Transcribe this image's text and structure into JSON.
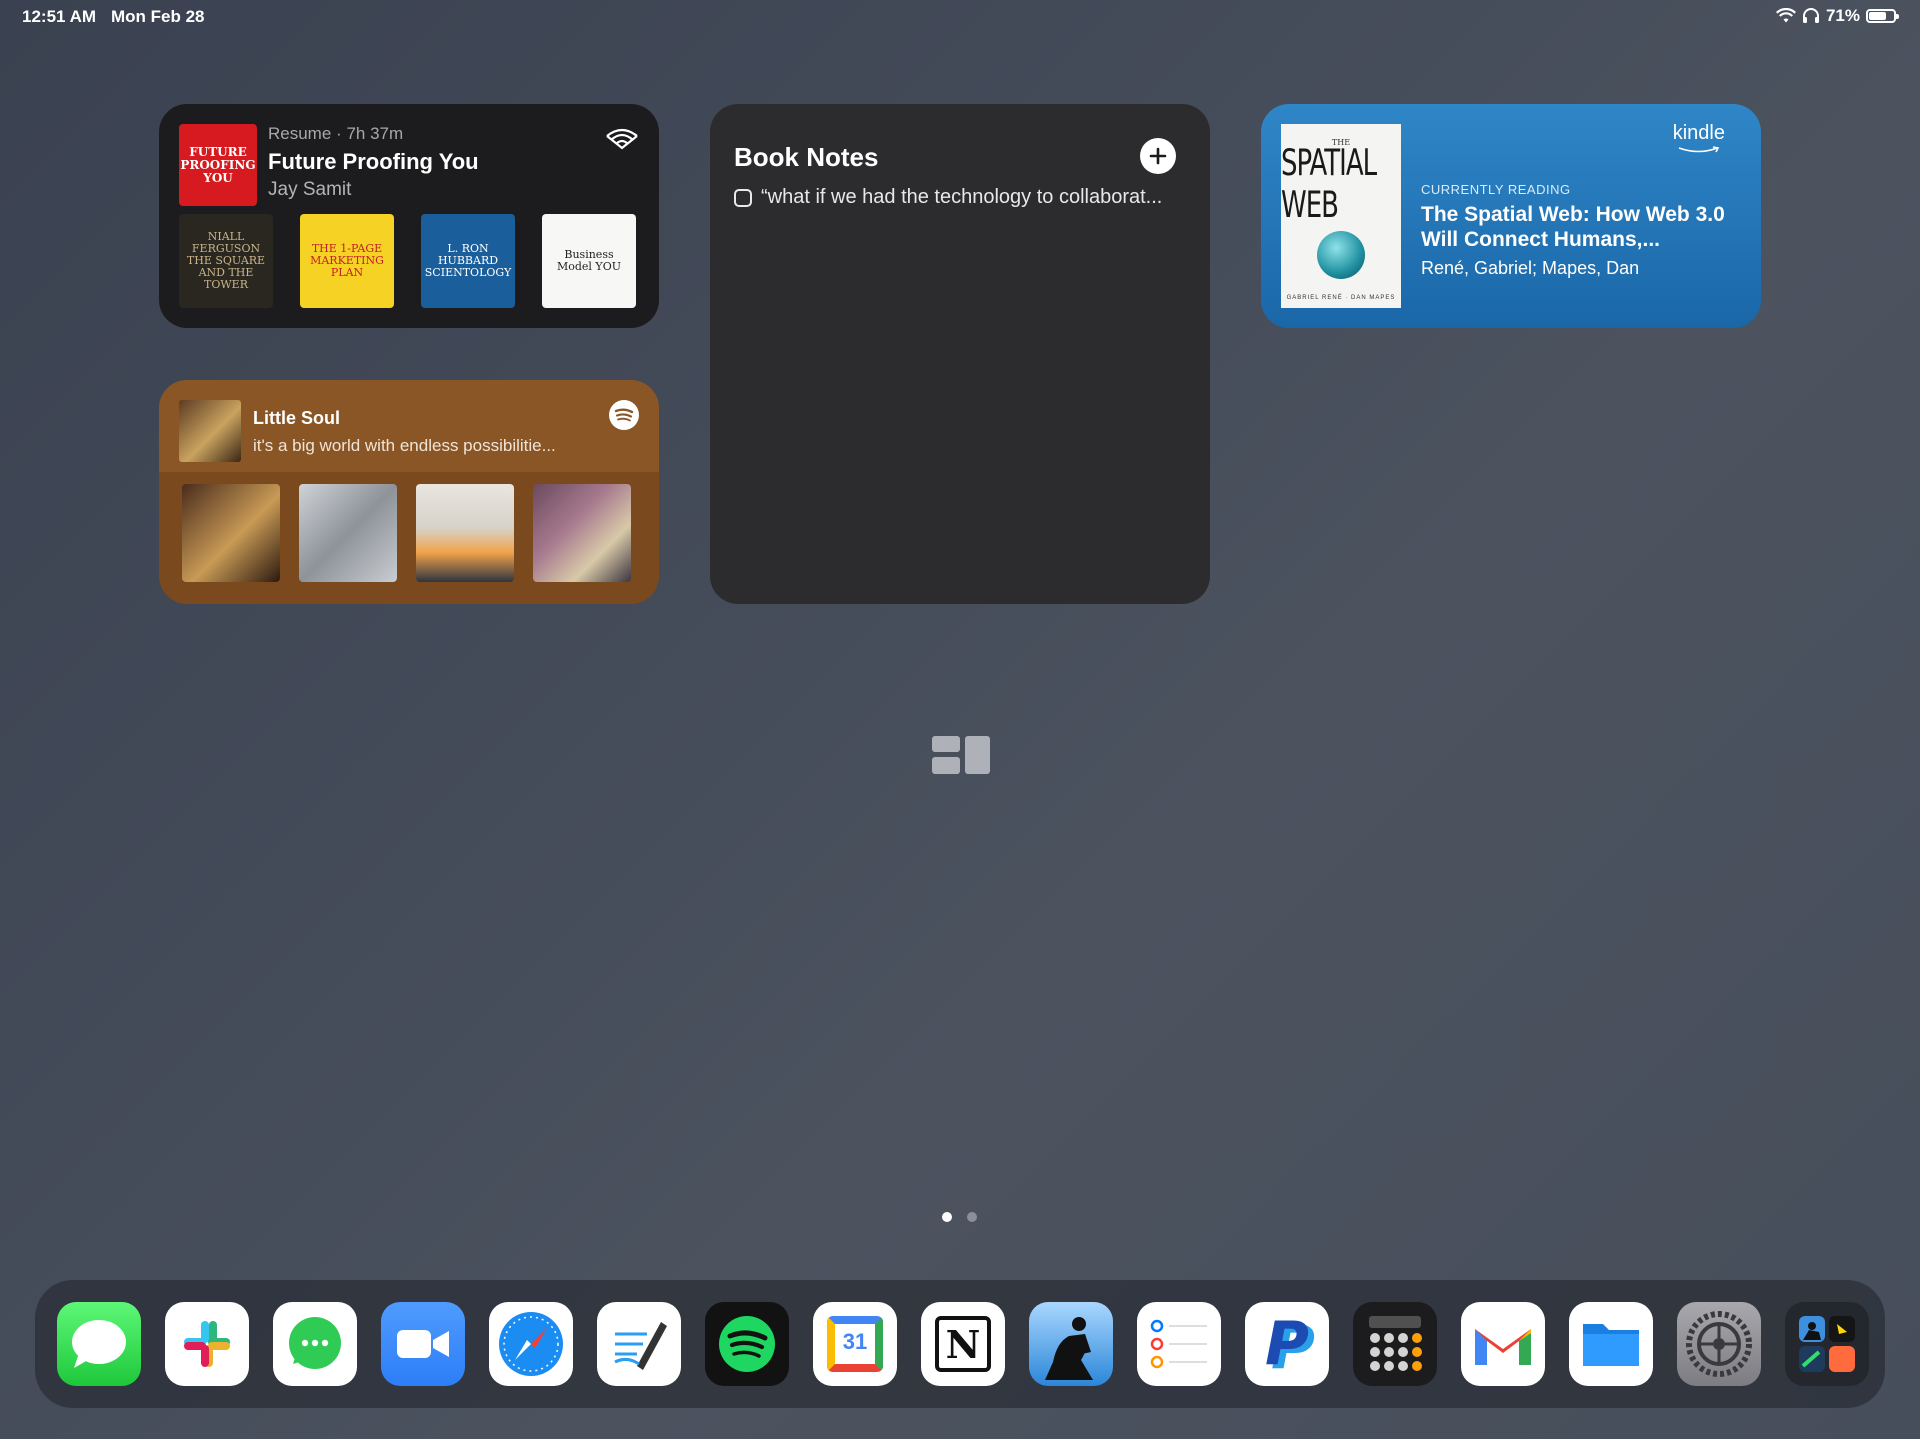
{
  "status_bar": {
    "time": "12:51 AM",
    "date": "Mon Feb 28",
    "battery_percent": "71%",
    "battery_level": 0.71
  },
  "audible_widget": {
    "resume_label": "Resume",
    "separator": "·",
    "time_left": "7h 37m",
    "title": "Future Proofing You",
    "author": "Jay Samit",
    "cover_text": [
      "FUTURE",
      "PROOFING",
      "YOU"
    ],
    "library_books": [
      {
        "text": "NIALL FERGUSON THE SQUARE AND THE TOWER",
        "bg": "#2a2620",
        "fg": "#c9b58a"
      },
      {
        "text": "THE 1-PAGE MARKETING PLAN",
        "bg": "#f5d224",
        "fg": "#c42027"
      },
      {
        "text": "L. RON HUBBARD SCIENTOLOGY",
        "bg": "#1a5e9c",
        "fg": "#ffffff"
      },
      {
        "text": "Business Model YOU",
        "bg": "#f7f7f5",
        "fg": "#222222"
      }
    ]
  },
  "notes_widget": {
    "title": "Book Notes",
    "items": [
      "“what if we had the technology to collaborat..."
    ]
  },
  "kindle_widget": {
    "logo": "kindle",
    "label": "CURRENTLY READING",
    "title": "The Spatial Web: How Web 3.0 Will Connect Humans,...",
    "author": "René, Gabriel; Mapes, Dan",
    "cover": {
      "top": "THE",
      "main": "SPATIAL WEB",
      "authors": "GABRIEL RENÉ · DAN MAPES"
    }
  },
  "spotify_widget": {
    "title": "Little Soul",
    "subtitle": "it's a big world with endless possibilitie...",
    "tiles": [
      {
        "gradient": "linear-gradient(135deg,#4a2c1c,#c89a55 55%,#2c1a10)"
      },
      {
        "gradient": "linear-gradient(135deg,#cfd2d6,#8e9399 50%,#c9ccd0)"
      },
      {
        "gradient": "linear-gradient(180deg,#e9e6e0 0%,#d7d2c8 45%,#f0a24a 70%,#2e3440 100%)"
      },
      {
        "gradient": "linear-gradient(135deg,#6b4a5e,#a77a8e 40%,#d8c9a8 70%,#3c3540)"
      }
    ]
  },
  "page_dots": {
    "count": 2,
    "active": 0
  },
  "dock": {
    "apps": [
      {
        "name": "Messages",
        "icon": "messages-icon"
      },
      {
        "name": "Slack",
        "icon": "slack-icon"
      },
      {
        "name": "WhatsApp",
        "icon": "whatsapp-icon"
      },
      {
        "name": "Zoom",
        "icon": "zoom-icon"
      },
      {
        "name": "Safari",
        "icon": "safari-icon"
      },
      {
        "name": "Notes Pen",
        "icon": "writing-app-icon"
      },
      {
        "name": "Spotify",
        "icon": "spotify-icon"
      },
      {
        "name": "Google Calendar",
        "icon": "calendar-icon",
        "badge": "31"
      },
      {
        "name": "Notion",
        "icon": "notion-icon",
        "badge": "N"
      },
      {
        "name": "Kindle",
        "icon": "kindle-icon"
      },
      {
        "name": "Reminders",
        "icon": "reminders-icon"
      },
      {
        "name": "PayPal",
        "icon": "paypal-icon",
        "badge": "P"
      },
      {
        "name": "Calculator",
        "icon": "calculator-icon"
      },
      {
        "name": "Gmail",
        "icon": "gmail-icon"
      },
      {
        "name": "Files",
        "icon": "files-icon"
      },
      {
        "name": "Settings",
        "icon": "settings-icon"
      },
      {
        "name": "App Library",
        "icon": "app-library-icon"
      }
    ]
  },
  "colors": {
    "audible_bg": "#1c1c1e",
    "notes_bg": "#2c2c2e",
    "kindle_bg": "#2f86c7",
    "spotify_bg": "#7a4a1e"
  }
}
